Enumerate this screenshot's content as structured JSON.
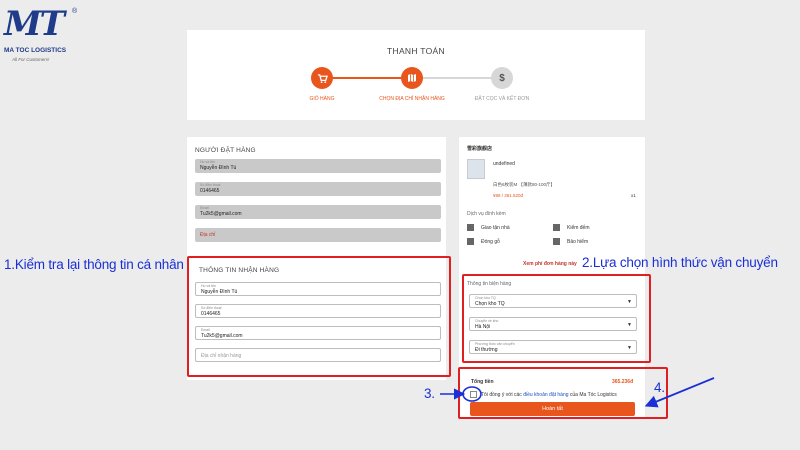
{
  "logo": {
    "mark": "MT",
    "registered": "®",
    "brand": "MA TOC LOGISTICS",
    "tagline": "All For Customers!"
  },
  "checkout": {
    "title": "THANH TOÁN",
    "steps": [
      {
        "label": "GIỎ HÀNG",
        "icon": "cart-icon",
        "state": "done"
      },
      {
        "label": "CHỌN ĐỊA CHỈ NHẬN HÀNG",
        "icon": "map-icon",
        "state": "active"
      },
      {
        "label": "ĐẶT CỌC VÀ KẾT ĐƠN",
        "icon": "dollar-icon",
        "glyph": "$",
        "state": "pending"
      }
    ]
  },
  "buyer": {
    "title": "NGƯỜI ĐẶT HÀNG",
    "name_label": "Họ và tên",
    "name_value": "Nguyễn Đình Tú",
    "phone_label": "Số điện thoại",
    "phone_value": "0146465",
    "email_label": "Email",
    "email_value": "Tu2k5@gmail.com",
    "address_label": "Địa chỉ"
  },
  "receiver": {
    "title": "THÔNG TIN NHẬN HÀNG",
    "name_label": "Họ và tên",
    "name_value": "Nguyễn Đình Tú",
    "phone_label": "Số điện thoại",
    "phone_value": "0146465",
    "email_label": "Email",
    "email_value": "Tu2k5@gmail.com",
    "address_placeholder": "Địa chỉ nhận hàng"
  },
  "order": {
    "shop_name": "雪彩旗舰店",
    "product_name": "undefined",
    "variant": "白色6枚装M 【薄款80-100斤】",
    "price": "¥98 / 361.520đ",
    "quantity": "x1",
    "services_title": "Dịch vụ đính kèm",
    "services": [
      "Giao tận nhà",
      "Kiểm đếm",
      "Đóng gỗ",
      "Bảo hiểm"
    ],
    "fee_link": "Xem phí đơn hàng này"
  },
  "shipping": {
    "title": "Thông tin biện hàng",
    "warehouse_label": "Chọn kho TQ",
    "warehouse_value": "Chọn kho TQ",
    "destination_label": "Chuyển về kho",
    "destination_value": "Hà Nội",
    "method_label": "Phương thức vận chuyển",
    "method_value": "Đi thường"
  },
  "summary": {
    "total_label": "Tổng tiền",
    "total_value": "365.236đ",
    "agree_prefix": "Tôi đồng ý với các",
    "agree_link": "điều khoản đặt hàng",
    "agree_suffix": "của Ma Tóc Logistics",
    "finish_button": "Hoàn tất"
  },
  "annotations": {
    "a1": "1.Kiểm tra lại thông tin cá nhân",
    "a2": "2.Lựa chọn hình thức vận chuyển",
    "a3": "3.",
    "a4": "4."
  },
  "colors": {
    "accent": "#e8561d",
    "annotation_blue": "#1a2fd6",
    "annotation_red": "#e02020",
    "pending_gray": "#d7d7d7"
  }
}
